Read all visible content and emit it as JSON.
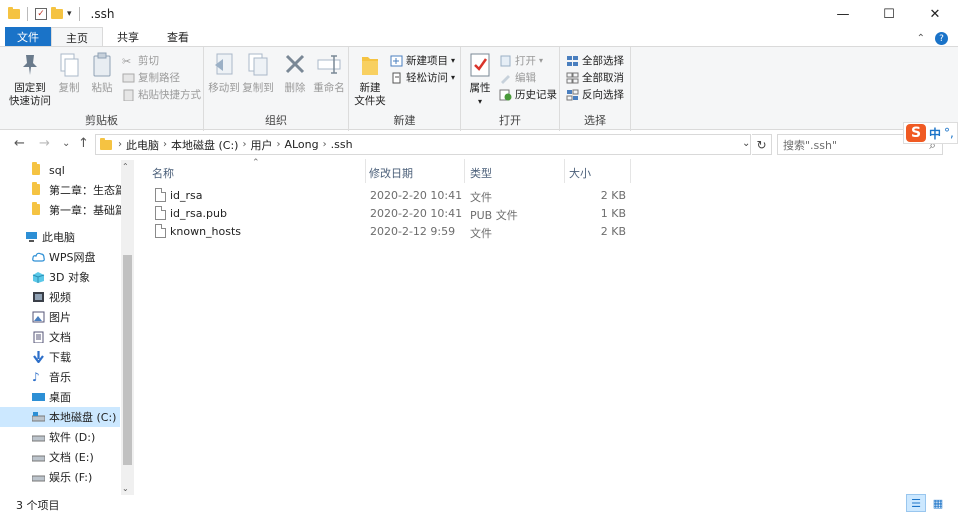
{
  "window": {
    "title": ".ssh",
    "quick_access_dropdown": "▾",
    "minimize": "—",
    "maximize": "☐",
    "close": "✕"
  },
  "ribbon_tabs": [
    "文件",
    "主页",
    "共享",
    "查看"
  ],
  "ribbon_controls": {
    "collapse": "⌃",
    "help": "?"
  },
  "ribbon": {
    "clipboard": {
      "label": "剪贴板",
      "pin": "固定到\n快速访问",
      "copy": "复制",
      "paste": "粘贴",
      "cut": "剪切",
      "copy_path": "复制路径",
      "paste_shortcut": "粘贴快捷方式"
    },
    "organize": {
      "label": "组织",
      "move_to": "移动到",
      "copy_to": "复制到",
      "delete": "删除",
      "rename": "重命名"
    },
    "new": {
      "label": "新建",
      "new_folder": "新建\n文件夹",
      "new_item": "新建项目",
      "easy_access": "轻松访问"
    },
    "open": {
      "label": "打开",
      "properties": "属性",
      "open": "打开",
      "edit": "编辑",
      "history": "历史记录"
    },
    "select": {
      "label": "选择",
      "select_all": "全部选择",
      "select_none": "全部取消",
      "invert": "反向选择"
    }
  },
  "address": {
    "back": "←",
    "forward": "→",
    "recent": "⌄",
    "up": "↑",
    "crumbs": [
      "此电脑",
      "本地磁盘 (C:)",
      "用户",
      "ALong",
      ".ssh"
    ],
    "dropdown": "⌄",
    "refresh": "↻"
  },
  "search": {
    "placeholder": "搜索\".ssh\"",
    "icon": "⌕"
  },
  "ime": {
    "logo": "S",
    "mode": "中",
    "punct": "°,"
  },
  "nav_pane": [
    {
      "label": "sql",
      "icon": "folder-icon"
    },
    {
      "label": "第二章：生态篇",
      "icon": "folder-icon"
    },
    {
      "label": "第一章：基础篇",
      "icon": "folder-icon"
    },
    {
      "label": "此电脑",
      "icon": "computer-icon"
    },
    {
      "label": "WPS网盘",
      "icon": "cloud-icon"
    },
    {
      "label": "3D 对象",
      "icon": "cube-icon"
    },
    {
      "label": "视频",
      "icon": "video-icon"
    },
    {
      "label": "图片",
      "icon": "picture-icon"
    },
    {
      "label": "文档",
      "icon": "document-icon"
    },
    {
      "label": "下载",
      "icon": "download-icon"
    },
    {
      "label": "音乐",
      "icon": "music-icon"
    },
    {
      "label": "桌面",
      "icon": "desktop-icon"
    },
    {
      "label": "本地磁盘 (C:)",
      "icon": "drive-icon",
      "selected": true
    },
    {
      "label": "软件 (D:)",
      "icon": "drive-icon"
    },
    {
      "label": "文档 (E:)",
      "icon": "drive-icon"
    },
    {
      "label": "娱乐 (F:)",
      "icon": "drive-icon"
    }
  ],
  "scroll_arrows": {
    "up": "⌃",
    "down": "⌄"
  },
  "columns": [
    "名称",
    "修改日期",
    "类型",
    "大小"
  ],
  "sort_indicator": "⌃",
  "files": [
    {
      "name": "id_rsa",
      "modified": "2020-2-20 10:41",
      "type": "文件",
      "size": "2 KB"
    },
    {
      "name": "id_rsa.pub",
      "modified": "2020-2-20 10:41",
      "type": "PUB 文件",
      "size": "1 KB"
    },
    {
      "name": "known_hosts",
      "modified": "2020-2-12 9:59",
      "type": "文件",
      "size": "2 KB"
    }
  ],
  "status": {
    "item_count": "3 个项目"
  },
  "view_buttons": {
    "details": "☰",
    "large_icons": "▦"
  },
  "colors": {
    "accent": "#1a73c8",
    "selection": "#cce8ff",
    "folder": "#f5c342"
  }
}
